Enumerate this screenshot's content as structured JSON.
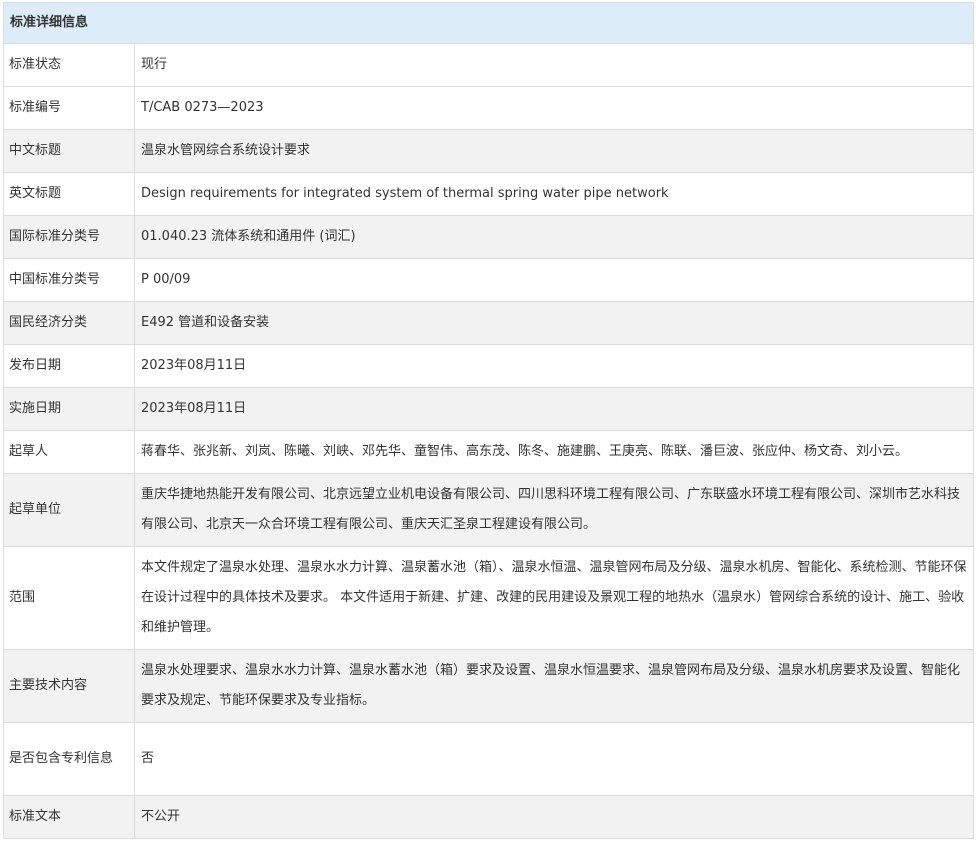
{
  "header": "标准详细信息",
  "rows": [
    {
      "label": "标准状态",
      "value": "现行"
    },
    {
      "label": "标准编号",
      "value": "T/CAB 0273—2023"
    },
    {
      "label": "中文标题",
      "value": "温泉水管网综合系统设计要求"
    },
    {
      "label": "英文标题",
      "value": "Design requirements for integrated system of thermal spring water pipe network"
    },
    {
      "label": "国际标准分类号",
      "value": "01.040.23 流体系统和通用件 (词汇)"
    },
    {
      "label": "中国标准分类号",
      "value": "P 00/09"
    },
    {
      "label": "国民经济分类",
      "value": "E492 管道和设备安装"
    },
    {
      "label": "发布日期",
      "value": "2023年08月11日"
    },
    {
      "label": "实施日期",
      "value": "2023年08月11日"
    },
    {
      "label": "起草人",
      "value": "蒋春华、张兆新、刘岚、陈曦、刘峡、邓先华、童智伟、高东茂、陈冬、施建鹏、王庚亮、陈联、潘巨波、张应仲、杨文奇、刘小云。"
    },
    {
      "label": "起草单位",
      "value": "重庆华捷地热能开发有限公司、北京远望立业机电设备有限公司、四川思科环境工程有限公司、广东联盛水环境工程有限公司、深圳市艺水科技有限公司、北京天一众合环境工程有限公司、重庆天汇圣泉工程建设有限公司。"
    },
    {
      "label": "范围",
      "value": "本文件规定了温泉水处理、温泉水水力计算、温泉蓄水池（箱）、温泉水恒温、温泉管网布局及分级、温泉水机房、智能化、系统检测、节能环保在设计过程中的具体技术及要求。 本文件适用于新建、扩建、改建的民用建设及景观工程的地热水（温泉水）管网综合系统的设计、施工、验收和维护管理。"
    },
    {
      "label": "主要技术内容",
      "value": "温泉水处理要求、温泉水水力计算、温泉水蓄水池（箱）要求及设置、温泉水恒温要求、温泉管网布局及分级、温泉水机房要求及设置、智能化要求及规定、节能环保要求及专业指标。"
    },
    {
      "label": "是否包含专利信息",
      "value": "否"
    },
    {
      "label": "标准文本",
      "value": "不公开"
    }
  ]
}
